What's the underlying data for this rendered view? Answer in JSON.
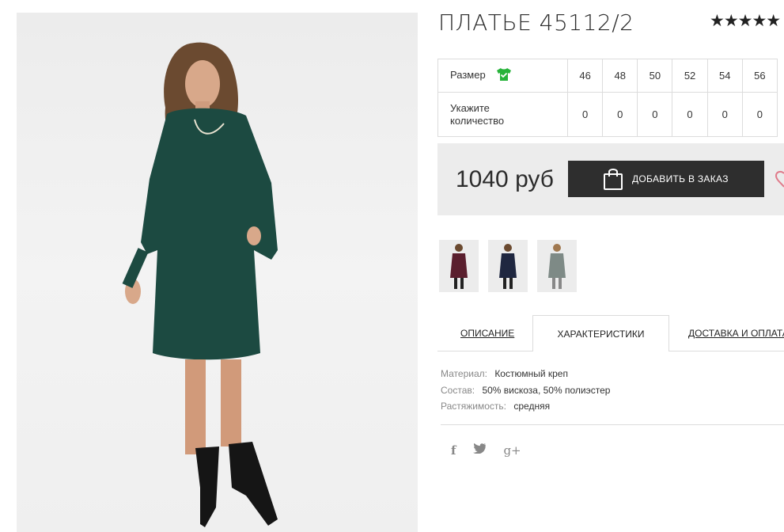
{
  "product": {
    "title": "ПЛАТЬЕ 45112/2",
    "rating_stars": "★★★★★",
    "price": "1040 руб",
    "add_to_order_label": "ДОБАВИТЬ В ЗАКАЗ"
  },
  "size_table": {
    "size_label": "Размер",
    "qty_label_line1": "Укажите",
    "qty_label_line2": "количество",
    "sizes": [
      "46",
      "48",
      "50",
      "52",
      "54",
      "56"
    ],
    "quantities": [
      "0",
      "0",
      "0",
      "0",
      "0",
      "0"
    ]
  },
  "thumbnails": {
    "colors": [
      "#5a1f2e",
      "#1f2740",
      "#7e8a86"
    ]
  },
  "tabs": {
    "description": "ОПИСАНИЕ",
    "characteristics": "ХАРАКТЕРИСТИКИ",
    "delivery": "ДОСТАВКА И ОПЛАТА"
  },
  "specs": [
    {
      "key": "Материал:",
      "value": "Костюмный креп"
    },
    {
      "key": "Состав:",
      "value": "50% вискоза, 50% полиэстер"
    },
    {
      "key": "Растяжимость:",
      "value": "средняя"
    }
  ],
  "social": {
    "facebook": "f",
    "twitter": "t",
    "googleplus": "g+"
  },
  "colors": {
    "dress": "#1c4a41",
    "button": "#2e2e2e",
    "accent_green": "#27b33a",
    "heart": "#e07a8a"
  }
}
